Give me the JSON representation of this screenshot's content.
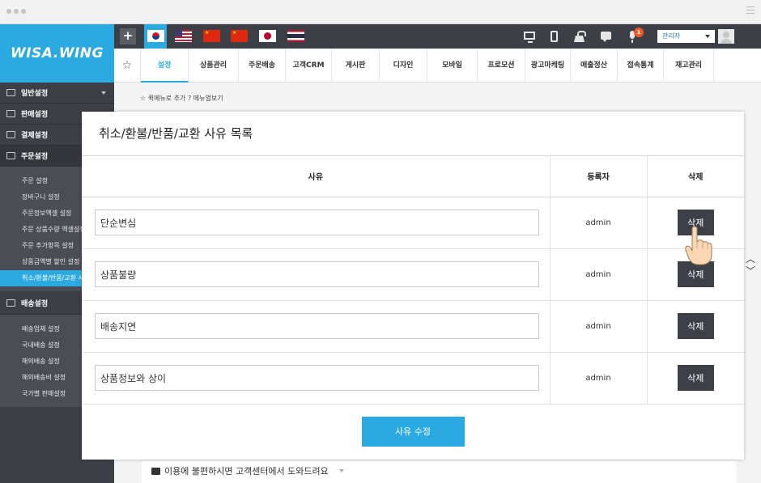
{
  "app": {
    "logo": "WISA.WING"
  },
  "topbar": {
    "add_label": "+",
    "flags": [
      "kr-flag-icon",
      "us-flag-icon",
      "cn-flag-icon",
      "hk-flag-icon",
      "jp-flag-icon",
      "th-flag-icon"
    ],
    "icons": [
      "monitor-icon",
      "mobile-icon",
      "basket-icon",
      "chat-icon",
      "mic-icon"
    ],
    "notification_count": "1",
    "admin_select": "관리자"
  },
  "menu": {
    "items": [
      "설정",
      "상품관리",
      "주문배송",
      "고객CRM",
      "게시판",
      "디자인",
      "모바일",
      "프로모션",
      "광고마케팅",
      "매출정산",
      "접속통계",
      "재고관리"
    ],
    "active": "설정"
  },
  "sidebar": {
    "sections": [
      {
        "label": "일반설정",
        "icon": "layout-icon"
      },
      {
        "label": "판매설정",
        "icon": "mail-icon"
      },
      {
        "label": "결제설정",
        "icon": "wallet-icon"
      },
      {
        "label": "주문설정",
        "icon": "document-icon"
      }
    ],
    "order_items": [
      "주문 설정",
      "장바구니 설정",
      "주문정보엑셀 설정",
      "주문 상품수량 엑셀설정",
      "주문 추가항목 설정",
      "상품금액별 할인 설정",
      "취소/환불/반품/교환 사유"
    ],
    "delivery_section": {
      "label": "배송설정",
      "icon": "truck-icon"
    },
    "delivery_items": [
      "배송업체 설정",
      "국내배송 설정",
      "해외배송 설정",
      "해외배송비 설정",
      "국가별 판매설정"
    ]
  },
  "quickbar": {
    "add_label": "퀵메뉴로 추가",
    "view_label": "메뉴열보기"
  },
  "help": {
    "text": "이용에 불편하시면 고객센터에서 도와드려요"
  },
  "modal": {
    "title": "취소/환불/반품/교환 사유 목록",
    "columns": {
      "reason": "사유",
      "author": "등록자",
      "delete": "삭제"
    },
    "rows": [
      {
        "reason": "단순변심",
        "author": "admin",
        "delete_label": "삭제"
      },
      {
        "reason": "상품불량",
        "author": "admin",
        "delete_label": "삭제"
      },
      {
        "reason": "배송지연",
        "author": "admin",
        "delete_label": "삭제"
      },
      {
        "reason": "상품정보와 상이",
        "author": "admin",
        "delete_label": "삭제"
      }
    ],
    "save_label": "사유 수정"
  },
  "colors": {
    "accent": "#2baae1",
    "sidebar": "#3c3f45",
    "button_dark": "#3d4047",
    "badge": "#ef5a24"
  }
}
